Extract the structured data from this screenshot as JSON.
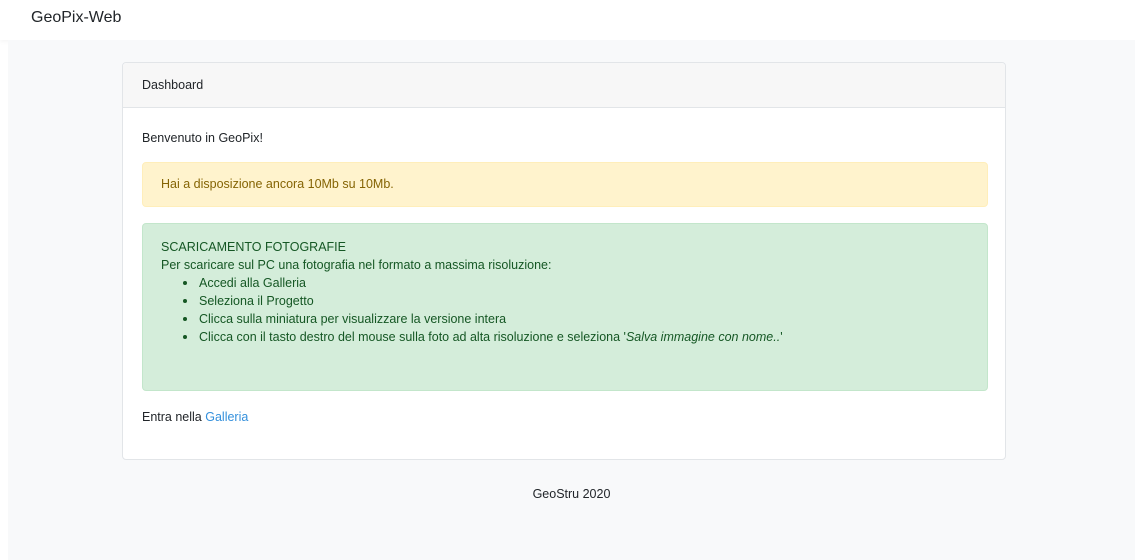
{
  "navbar": {
    "brand": "GeoPix-Web"
  },
  "card": {
    "header": "Dashboard",
    "welcome": "Benvenuto in GeoPix!",
    "quota_alert": "Hai a disposizione ancora 10Mb su 10Mb.",
    "download_info": {
      "title": "SCARICAMENTO FOTOGRAFIE",
      "intro": "Per scaricare sul PC una fotografia nel formato a massima risoluzione:",
      "steps": [
        "Accedi alla Galleria",
        "Seleziona il Progetto",
        "Clicca sulla miniatura per visualizzare la versione intera"
      ],
      "last_step_prefix": "Clicca con il tasto destro del mouse sulla foto ad alta risoluzione e seleziona '",
      "last_step_italic": "Salva immagine con nome..",
      "last_step_suffix": "'"
    },
    "enter_prefix": "Entra nella",
    "gallery_link": "Galleria"
  },
  "footer": {
    "text": "GeoStru 2020"
  },
  "colors": {
    "link": "#3490dc",
    "warning_bg": "#fff3cd",
    "warning_text": "#856404",
    "success_bg": "#d4edda",
    "success_text": "#155724"
  }
}
